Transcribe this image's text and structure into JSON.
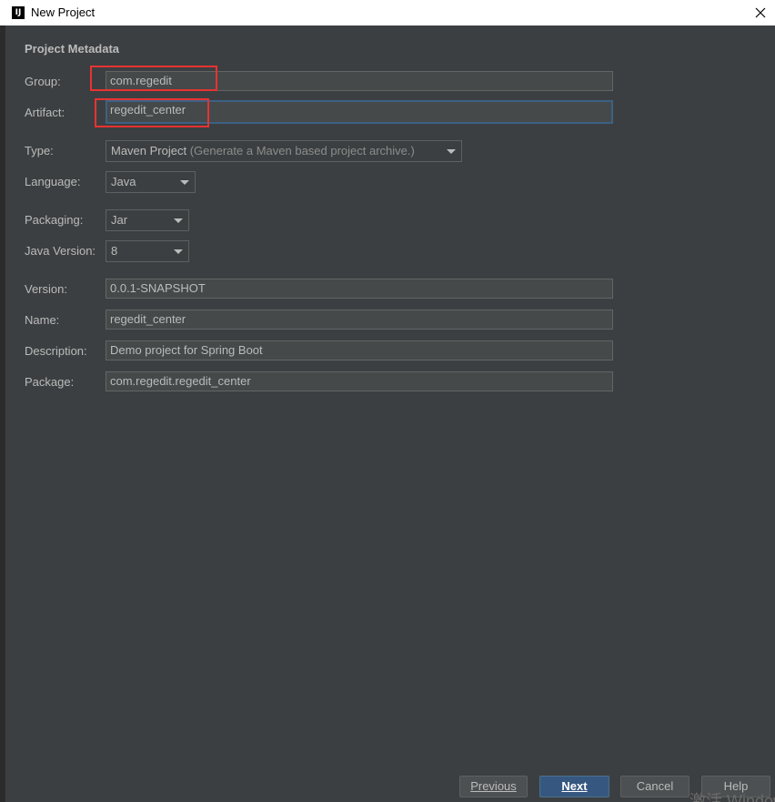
{
  "window": {
    "title": "New Project",
    "app_icon_text": "IJ"
  },
  "section_title": "Project Metadata",
  "fields": {
    "group": {
      "label": "Group:",
      "value": "com.regedit"
    },
    "artifact": {
      "label": "Artifact:",
      "value": "regedit_center"
    },
    "type": {
      "label": "Type:",
      "value": "Maven Project",
      "hint": "(Generate a Maven based project archive.)"
    },
    "language": {
      "label": "Language:",
      "value": "Java"
    },
    "packaging": {
      "label": "Packaging:",
      "value": "Jar"
    },
    "java_version": {
      "label": "Java Version:",
      "value": "8"
    },
    "version": {
      "label": "Version:",
      "value": "0.0.1-SNAPSHOT"
    },
    "name": {
      "label": "Name:",
      "value": "regedit_center"
    },
    "description": {
      "label": "Description:",
      "value": "Demo project for Spring Boot"
    },
    "package": {
      "label": "Package:",
      "value": "com.regedit.regedit_center"
    }
  },
  "buttons": {
    "previous": "Previous",
    "next": "Next",
    "cancel": "Cancel",
    "help": "Help"
  },
  "watermark": "激活 Windows",
  "colors": {
    "background": "#3c3f41",
    "highlight": "#e83232",
    "primary_button": "#365880"
  }
}
